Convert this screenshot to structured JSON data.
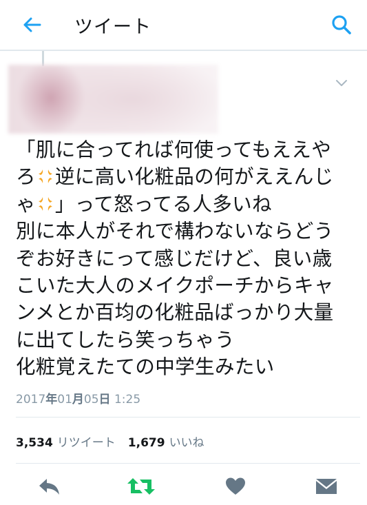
{
  "header": {
    "title": "ツイート",
    "back_icon": "arrow-left-icon",
    "search_icon": "search-icon",
    "accent_color": "#1da1f2"
  },
  "tweet": {
    "lines": [
      "「肌に合ってれば何使ってもええや",
      "ろ💢逆に高い化粧品の何がええんじ",
      "ゃ💢」って怒ってる人多いね",
      "別に本人がそれで構わないならどう",
      "ぞお好きにって感じだけど、良い歳",
      "こいた大人のメイクポーチからキャ",
      "ンメとか百均の化粧品ばっかり大量",
      "に出てしたら笑っちゃう",
      "化粧覚えたての中学生みたい"
    ],
    "line_parts": [
      [
        "「肌に合ってれば何使ってもええや"
      ],
      [
        "ろ",
        "💢",
        "逆に高い化粧品の何がええんじ"
      ],
      [
        "ゃ",
        "💢",
        "」って怒ってる人多いね"
      ],
      [
        "別に本人がそれで構わないならどう"
      ],
      [
        "ぞお好きにって感じだけど、良い歳"
      ],
      [
        "こいた大人のメイクポーチからキャ"
      ],
      [
        "ンメとか百均の化粧品ばっかり大量"
      ],
      [
        "に出てしたら笑っちゃう"
      ],
      [
        "化粧覚えたての中学生みたい"
      ]
    ],
    "timestamp": {
      "year": "2017",
      "year_unit": "年",
      "month": "01",
      "month_unit": "月",
      "day": "05",
      "day_unit": "日",
      "time": "1:25"
    },
    "stats": {
      "retweet_count": "3,534",
      "retweet_label": "リツイート",
      "like_count": "1,679",
      "like_label": "いいね"
    },
    "emoji_icon": "anger-symbol-icon",
    "emoji_color": "#f5a623",
    "retweet_color": "#17bf63",
    "action_color": "#657786"
  }
}
